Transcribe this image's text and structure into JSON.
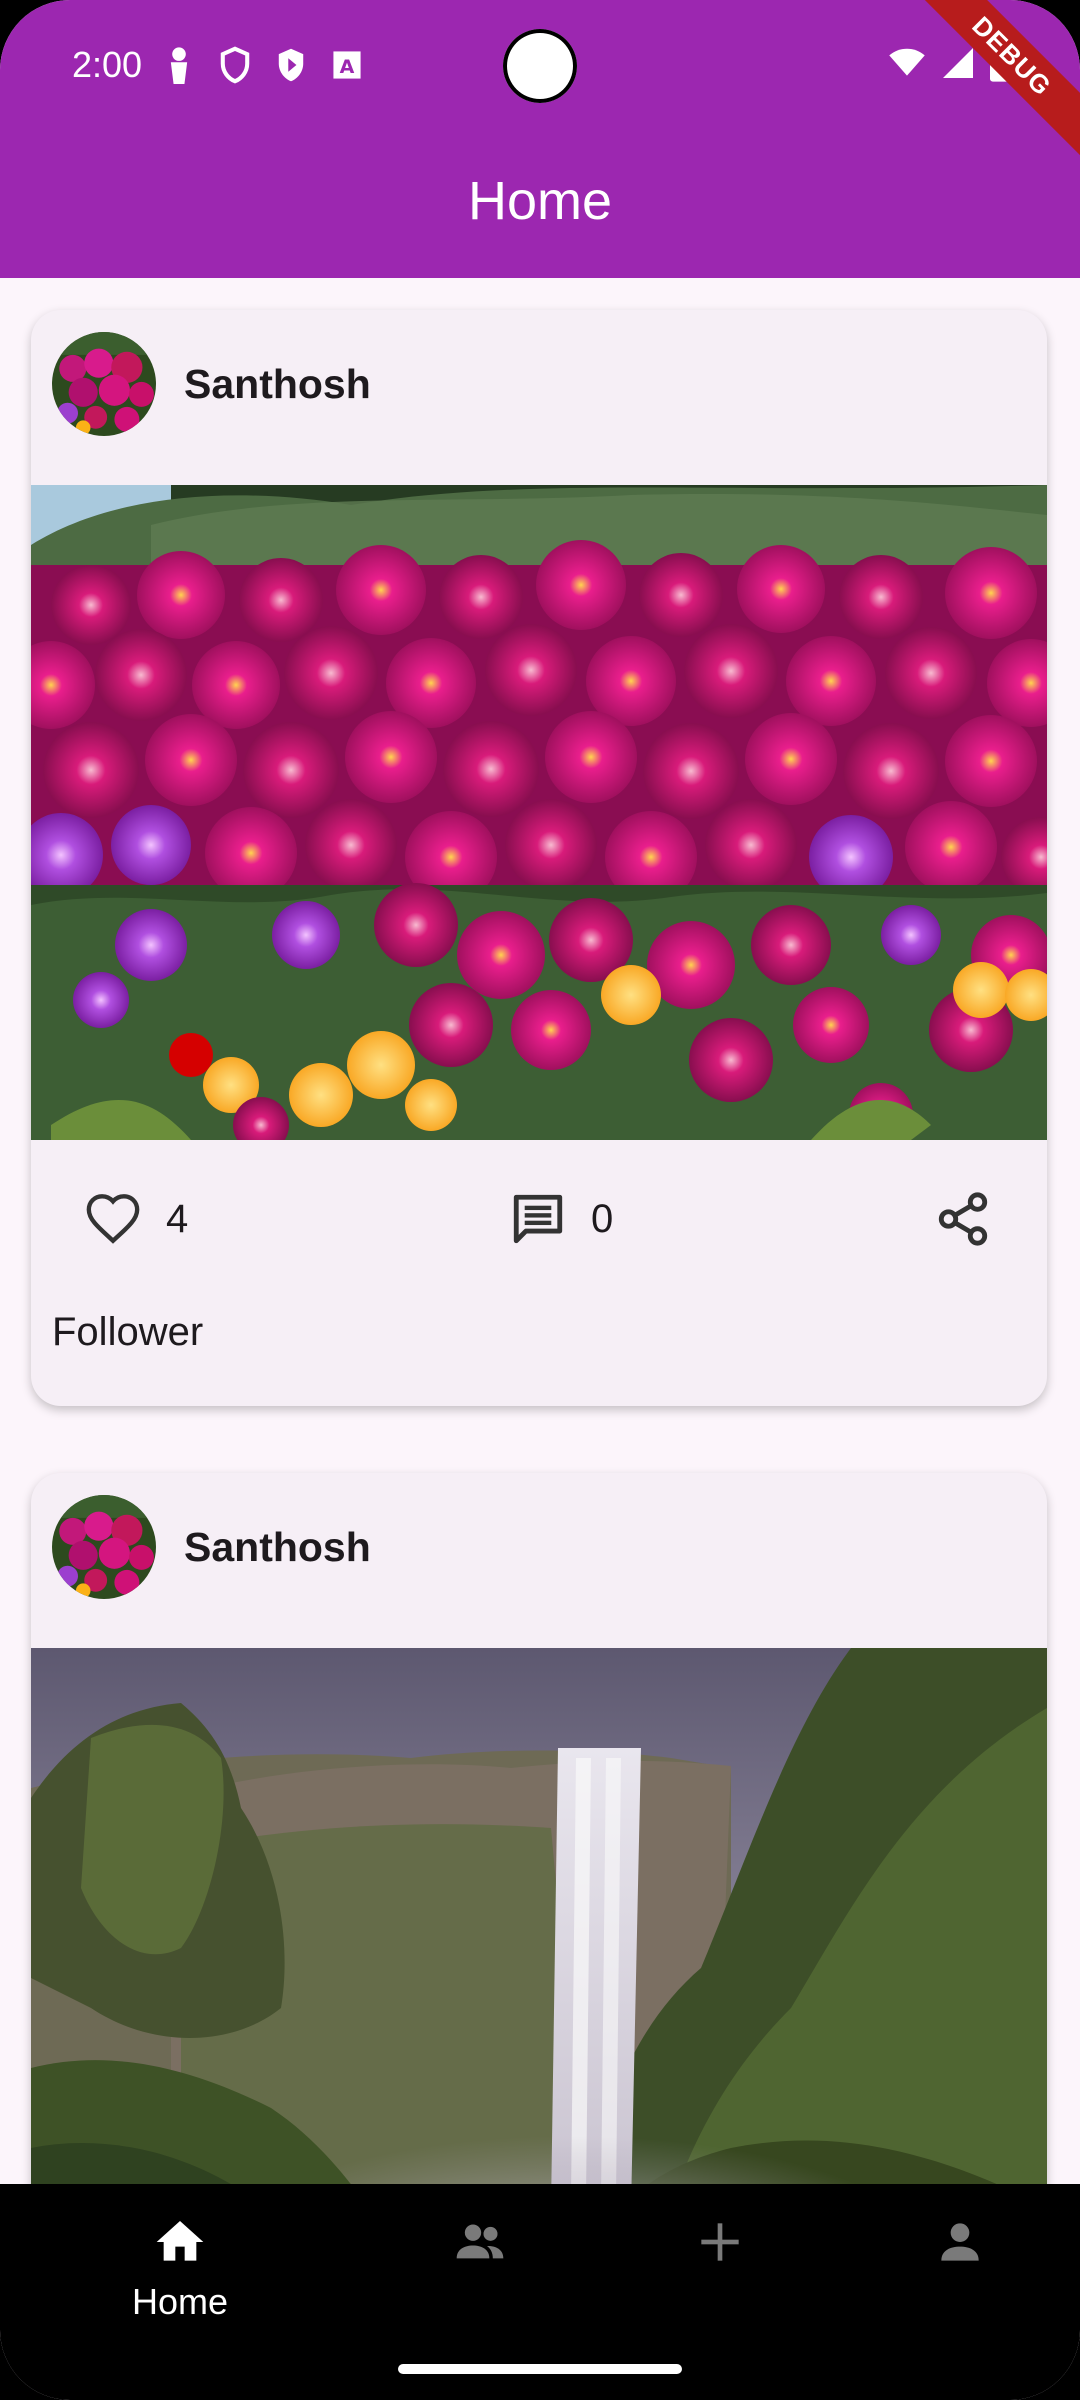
{
  "status_bar": {
    "time": "2:00",
    "debug_label": "DEBUG"
  },
  "app_bar": {
    "title": "Home",
    "color": "#9c27b0"
  },
  "posts": [
    {
      "username": "Santhosh",
      "image": "pink-ice-plant-flowers",
      "likes": "4",
      "comments": "0",
      "caption": "Follower"
    },
    {
      "username": "Santhosh",
      "image": "waterfall-cliffs"
    }
  ],
  "bottom_nav": {
    "items": [
      {
        "label": "Home",
        "icon": "home-icon",
        "selected": true
      },
      {
        "label": "",
        "icon": "people-icon",
        "selected": false
      },
      {
        "label": "",
        "icon": "add-icon",
        "selected": false
      },
      {
        "label": "",
        "icon": "person-icon",
        "selected": false
      }
    ]
  },
  "icons": {
    "like": "heart-outline-icon",
    "comment": "comment-icon",
    "share": "share-icon"
  }
}
